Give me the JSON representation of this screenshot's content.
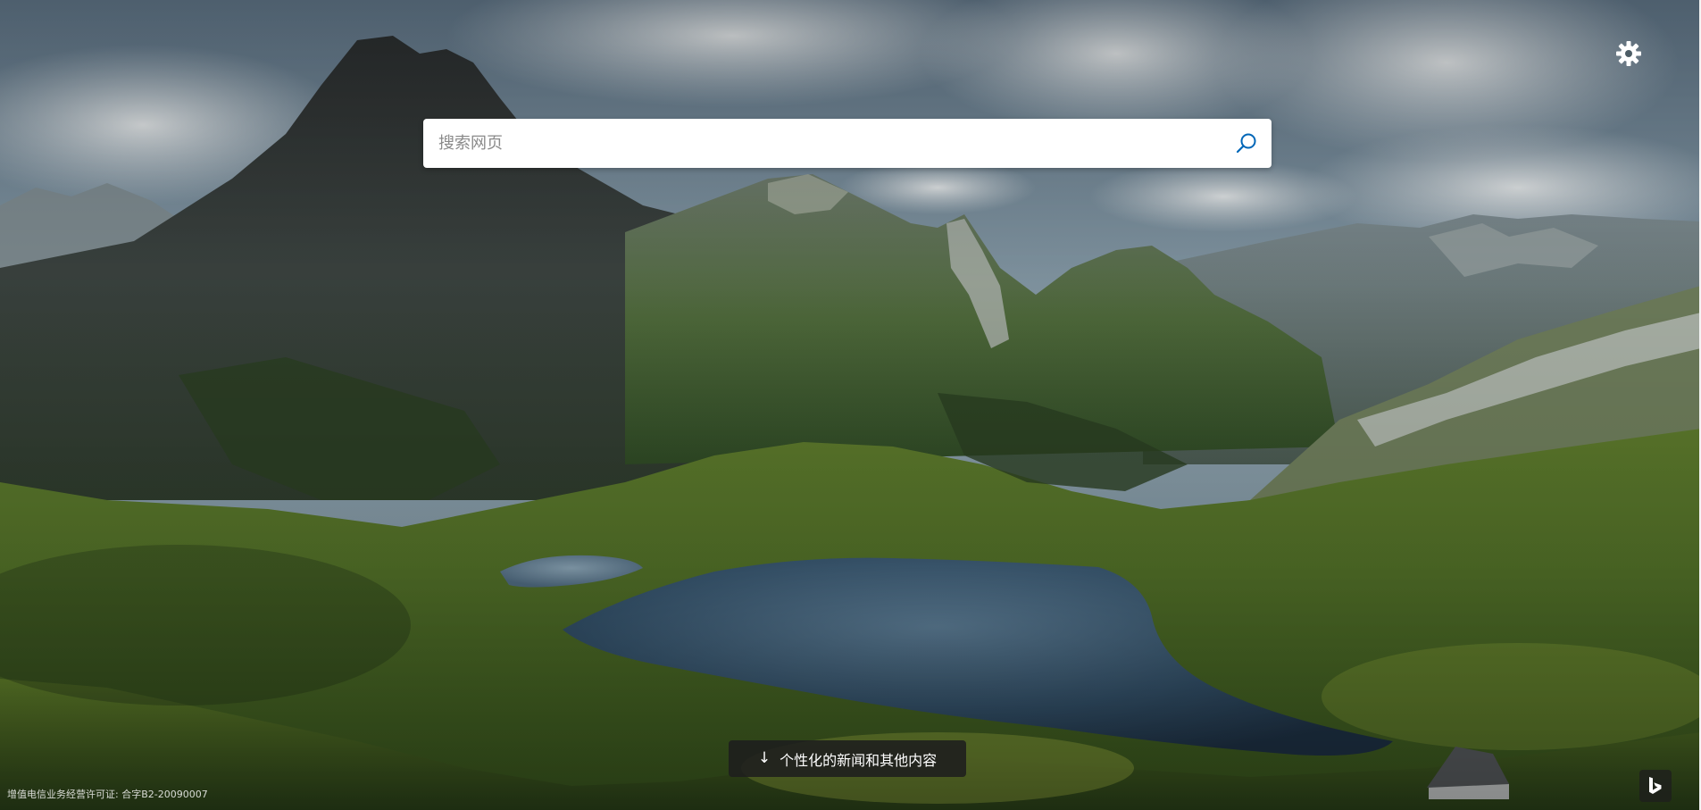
{
  "search": {
    "placeholder": "搜索网页",
    "value": ""
  },
  "news_button": {
    "arrow": "↓",
    "label": "个性化的新闻和其他内容"
  },
  "footer": {
    "license": "增值电信业务经营许可证: 合字B2-20090007"
  },
  "icons": {
    "settings": "gear-icon",
    "search": "search-icon",
    "brand": "bing-logo-icon"
  },
  "colors": {
    "accent": "#0067b8",
    "search_box": "#ffffff",
    "overlay_button": "#1e1e1e"
  }
}
